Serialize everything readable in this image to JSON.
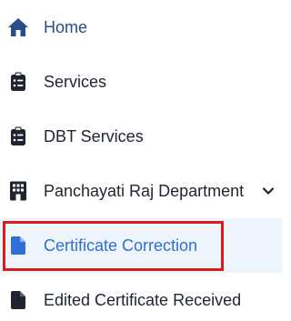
{
  "sidebar": {
    "items": [
      {
        "label": "Home",
        "icon": "home-icon"
      },
      {
        "label": "Services",
        "icon": "clipboard-list-icon"
      },
      {
        "label": "DBT Services",
        "icon": "clipboard-list-icon"
      },
      {
        "label": "Panchayati Raj Department",
        "icon": "building-icon",
        "expandable": true
      },
      {
        "label": "Certificate Correction",
        "icon": "file-icon",
        "active": true
      },
      {
        "label": "Edited Certificate Received",
        "icon": "file-icon"
      }
    ]
  },
  "colors": {
    "home_text": "#2b4c8a",
    "active_text": "#2f6fd6",
    "active_bg": "#eef4fb",
    "highlight_border": "#d81b1b",
    "icon_dark": "#1f2430",
    "icon_blue": "#2f6fd6"
  }
}
